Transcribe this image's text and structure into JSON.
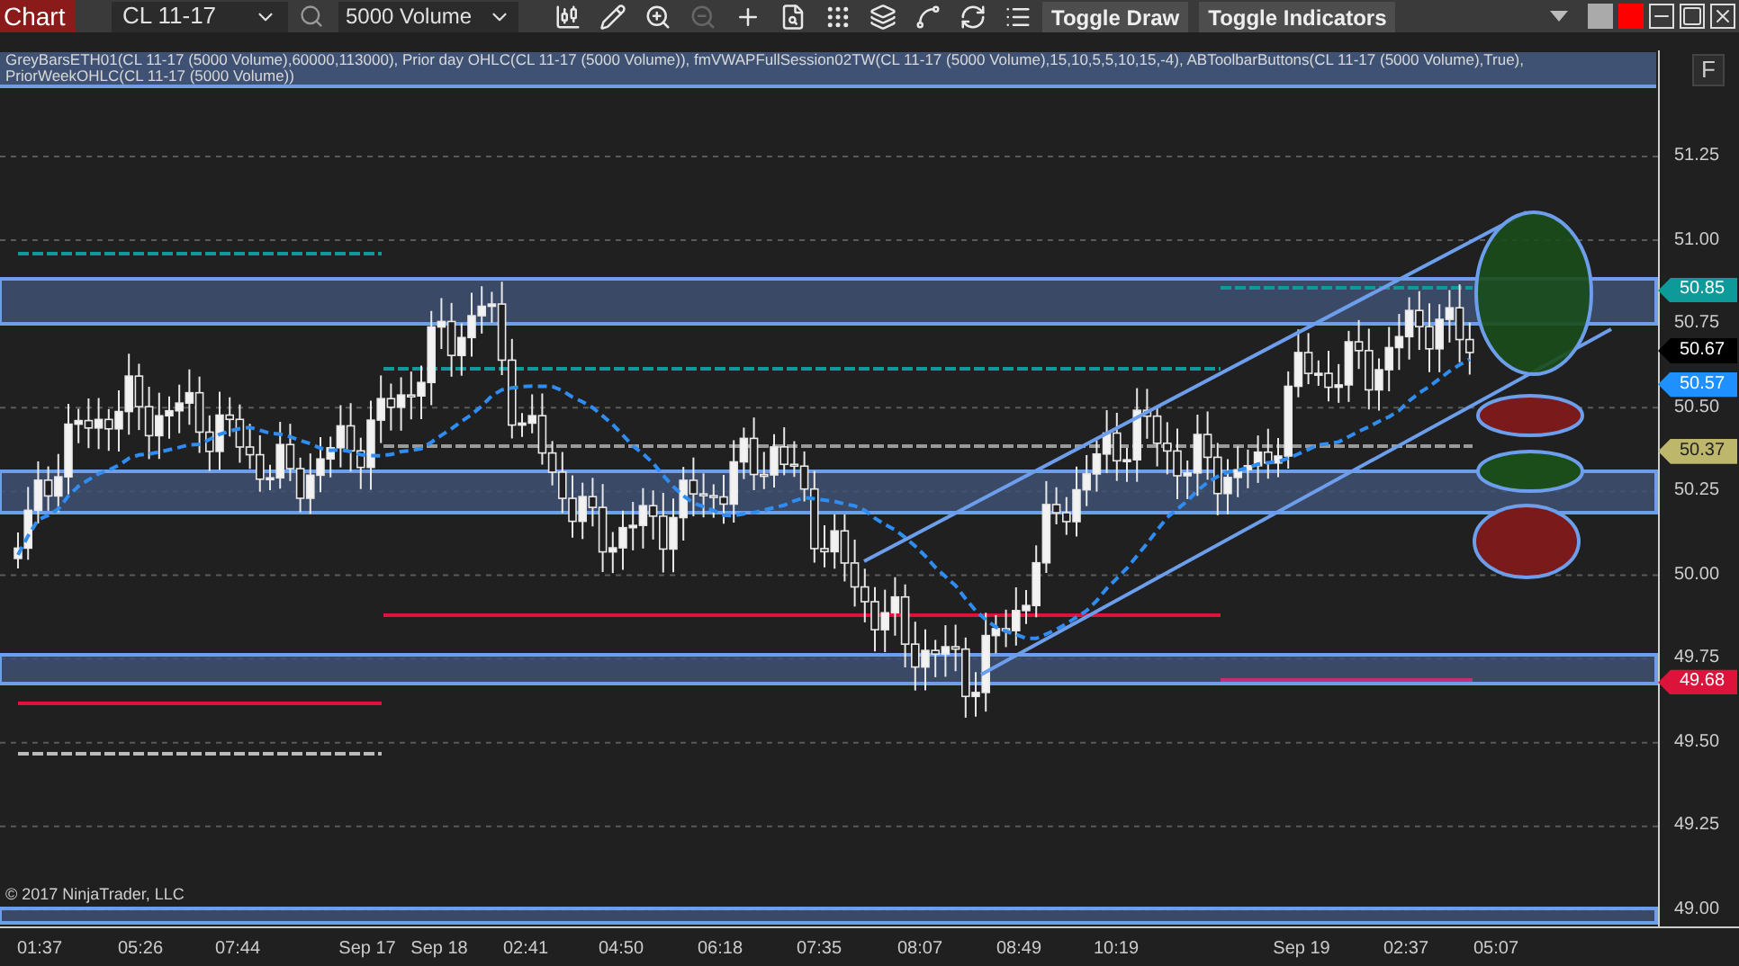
{
  "toolbar": {
    "title": "Chart",
    "instrument": "CL 11-17",
    "bar_type": "5000 Volume",
    "tools": [
      {
        "kind": "candles",
        "disabled": false
      },
      {
        "kind": "pencil",
        "disabled": false
      },
      {
        "kind": "zoom-in",
        "disabled": false
      },
      {
        "kind": "zoom-out",
        "disabled": true
      },
      {
        "kind": "crosshair",
        "disabled": false
      },
      {
        "kind": "properties",
        "disabled": false
      },
      {
        "kind": "grid",
        "disabled": false
      },
      {
        "kind": "layers",
        "disabled": false
      },
      {
        "kind": "spline",
        "disabled": false
      },
      {
        "kind": "refresh",
        "disabled": false
      },
      {
        "kind": "list",
        "disabled": false
      }
    ],
    "buttons": [
      "Toggle Draw",
      "Toggle Indicators"
    ]
  },
  "indicator_labels": [
    "GreyBarsETH01(CL 11-17 (5000 Volume),60000,113000), Prior day OHLC(CL 11-17 (5000 Volume)), fmVWAPFullSession02TW(CL 11-17 (5000 Volume),15,10,5,5,10,15,-4), ABToolbarButtons(CL 11-17 (5000 Volume),True),",
    "PriorWeekOHLC(CL 11-17 (5000 Volume))"
  ],
  "f_button": "F",
  "price_axis": {
    "ticks": [
      "51.25",
      "51.00",
      "50.75",
      "50.50",
      "50.25",
      "50.00",
      "49.75",
      "49.50",
      "49.25",
      "49.00"
    ],
    "markers": [
      {
        "price": "50.85",
        "color": "#0f9a9a"
      },
      {
        "price": "50.67",
        "color": "#000000"
      },
      {
        "price": "50.57",
        "color": "#1e90ff"
      },
      {
        "price": "50.37",
        "color": "#bdb76b"
      },
      {
        "price": "49.68",
        "color": "#dc143c"
      }
    ]
  },
  "time_axis": [
    "01:37",
    "05:26",
    "07:44",
    "Sep 17",
    "Sep 18",
    "02:41",
    "04:50",
    "06:18",
    "07:35",
    "08:07",
    "08:49",
    "10:19",
    "Sep 19",
    "02:37",
    "05:07"
  ],
  "copyright": "© 2017 NinjaTrader, LLC"
}
